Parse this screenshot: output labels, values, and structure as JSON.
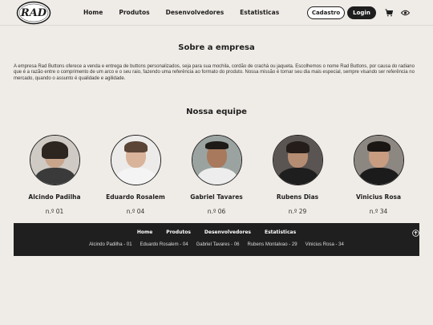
{
  "header": {
    "logo_text": "RAD",
    "nav": [
      "Home",
      "Produtos",
      "Desenvolvedores",
      "Estatisticas"
    ],
    "cadastro_label": "Cadastro",
    "login_label": "Login",
    "icons": [
      "cart-icon",
      "eye-icon"
    ]
  },
  "about": {
    "title": "Sobre a empresa",
    "text": "A empresa Rad Buttons oferece a venda e entrega de buttons personalizados, seja para sua mochila, cordão de crachá ou jaqueta. Escolhemos o nome Rad Buttons, por causa do radiano que é a razão entre o comprimento de um arco e o seu raio, fazendo uma referência ao formato do produto. Nossa missão é tornar seu dia mais especial, sempre visando ser referência no mercado, quando o assunto é qualidade e agilidade."
  },
  "team": {
    "title": "Nossa equipe",
    "members": [
      {
        "name": "Alcindo Padilha",
        "number": "n.º 01"
      },
      {
        "name": "Eduardo Rosalem",
        "number": "n.º 04"
      },
      {
        "name": "Gabriel Tavares",
        "number": "n.º 06"
      },
      {
        "name": "Rubens Dias",
        "number": "n.º 29"
      },
      {
        "name": "Vinicius Rosa",
        "number": "n.º 34"
      }
    ]
  },
  "footer": {
    "nav": [
      "Home",
      "Produtos",
      "Desenvolvedores",
      "Estatisticas"
    ],
    "members": [
      "Alcindo Padilha - 01",
      "Eduardo Rosalem - 04",
      "Gabriel Tavares - 06",
      "Rubens Montalvao - 29",
      "Vinicius Rosa - 34"
    ],
    "icon": "arrow-up-circle-icon"
  },
  "colors": {
    "background": "#efebe6",
    "dark": "#1e1e1e",
    "footer": "#1f1f1f"
  }
}
